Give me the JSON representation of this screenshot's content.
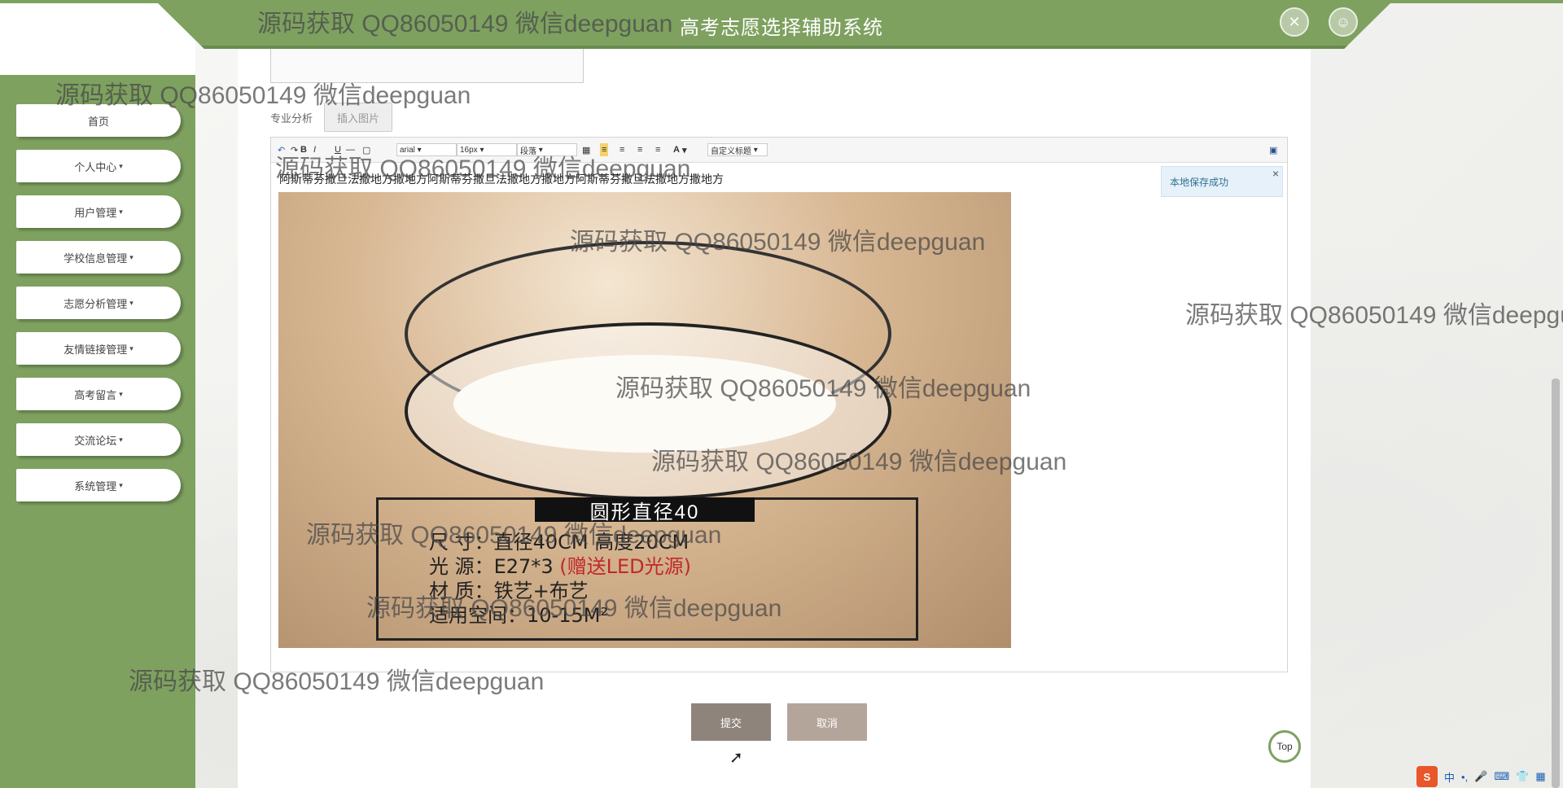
{
  "header": {
    "title": "高考志愿选择辅助系统",
    "icons": [
      "close-circle-icon",
      "user-icon"
    ]
  },
  "sidebar": {
    "items": [
      {
        "label": "首页",
        "has_caret": false
      },
      {
        "label": "个人中心",
        "has_caret": true
      },
      {
        "label": "用户管理",
        "has_caret": true
      },
      {
        "label": "学校信息管理",
        "has_caret": true
      },
      {
        "label": "志愿分析管理",
        "has_caret": true
      },
      {
        "label": "友情链接管理",
        "has_caret": true
      },
      {
        "label": "高考留言",
        "has_caret": true
      },
      {
        "label": "交流论坛",
        "has_caret": true
      },
      {
        "label": "系统管理",
        "has_caret": true
      }
    ],
    "caret": "▾"
  },
  "form": {
    "field_label": "专业分析",
    "insert_image_label": "插入图片"
  },
  "editor": {
    "toolbar": {
      "font_family": "arial",
      "font_size": "16px",
      "paragraph": "段落",
      "custom_title": "自定义标题",
      "bold": "B",
      "underline": "U",
      "font_color": "A"
    },
    "content_text": "阿斯蒂芬撒旦法撒地方撒地方阿斯蒂芬撒旦法撒地方撒地方阿斯蒂芬撒旦法撒地方撒地方",
    "image": {
      "spec_title": "圆形直径40",
      "spec_line1": "尺      寸：直径40CM  高度20CM",
      "spec_line2a": "光      源：E27*3 ",
      "spec_line2b": "(赠送LED光源)",
      "spec_line3": "材      质：铁艺+布艺",
      "spec_line4": "适用空间：10-15M²"
    },
    "toast": "本地保存成功",
    "toast_close": "×"
  },
  "actions": {
    "submit": "提交",
    "cancel": "取消",
    "top": "Top"
  },
  "ime": {
    "logo": "S",
    "mode": "中"
  },
  "watermark": "源码获取 QQ86050149 微信deepguan",
  "colors": {
    "brand_green": "#7ea160",
    "submit": "#8f847c",
    "cancel": "#b4a59b"
  }
}
